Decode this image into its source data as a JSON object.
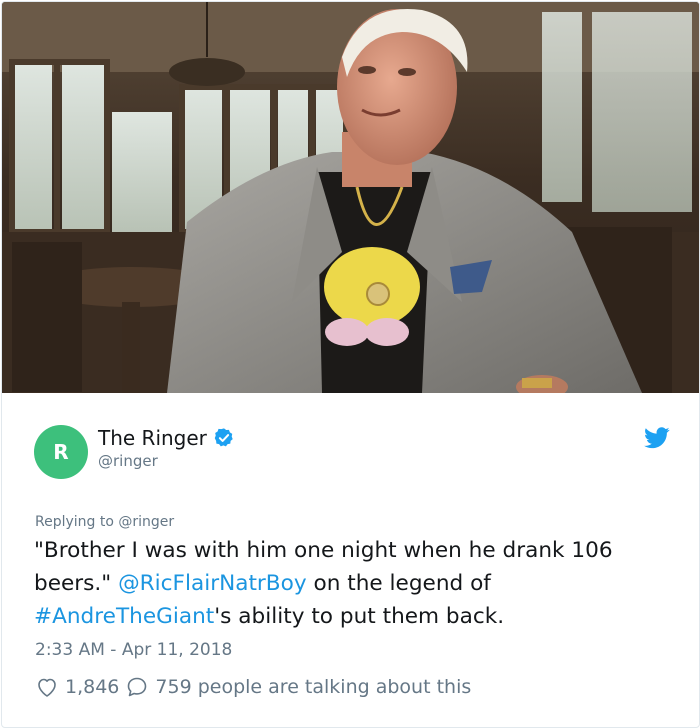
{
  "account": {
    "avatar_letter": "R",
    "display_name": "The Ringer",
    "handle": "@ringer",
    "verified": true
  },
  "tweet": {
    "replying_to": "Replying to @ringer",
    "text_part1": "\"Brother I was with him one night when he drank 106 beers.\" ",
    "mention": "@RicFlairNatrBoy",
    "text_part2": " on the legend of ",
    "hashtag": "#AndreTheGiant",
    "text_part3": "'s ability to put them back.",
    "timestamp": "2:33 AM - Apr 11, 2018"
  },
  "engagement": {
    "likes": "1,846",
    "replies_text": "759 people are talking about this"
  },
  "icons": {
    "verified": "verified-badge-icon",
    "platform": "twitter-bird-icon",
    "like": "heart-icon",
    "reply": "speech-bubble-icon"
  },
  "colors": {
    "link": "#1b95e0",
    "avatar_bg": "#3dc07c",
    "muted": "#657786",
    "text": "#14171a"
  }
}
